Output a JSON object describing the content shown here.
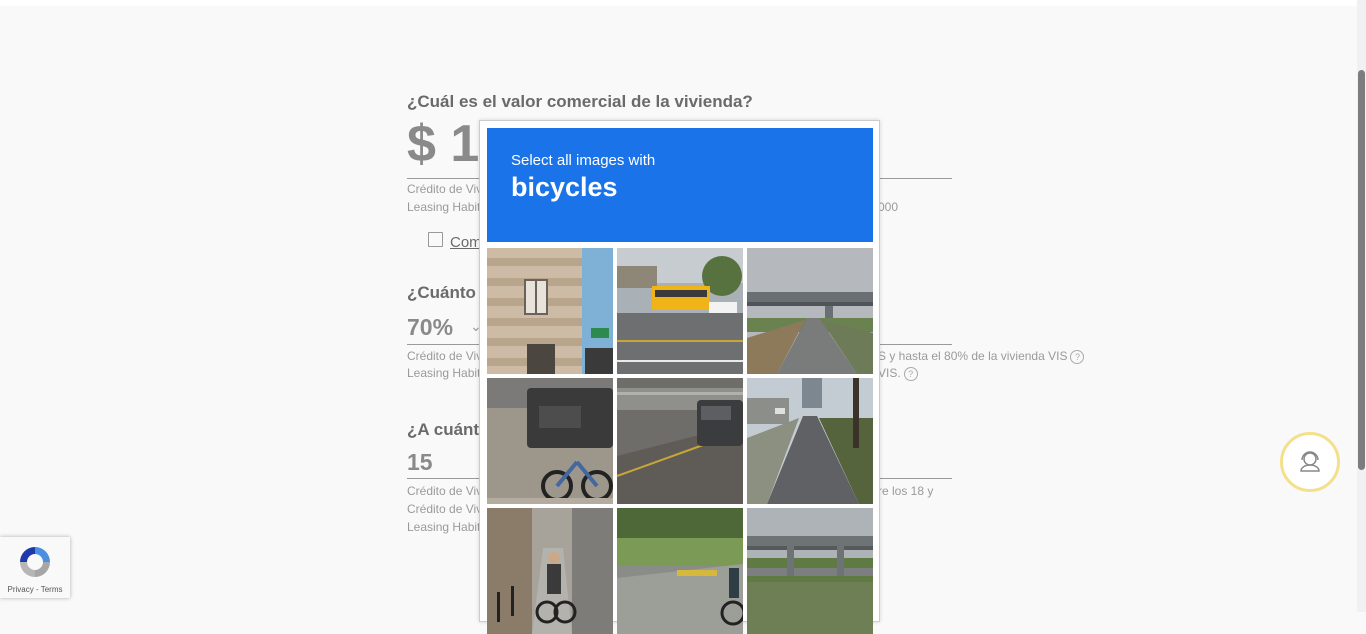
{
  "form": {
    "q1": {
      "label": "¿Cuál es el valor comercial de la vivienda?",
      "value": "$ 1",
      "note1": "Crédito de Viv",
      "note2": "Leasing Habit",
      "note_tail": "000",
      "link_label": "Com"
    },
    "q2": {
      "label": "¿Cuánto d",
      "value": "70%",
      "note1": "Crédito de Viv",
      "note2": "Leasing Habit",
      "note1_tail": "S y hasta el 80% de la vivienda VIS",
      "note2_tail": "VIS.",
      "help_glyph": "?"
    },
    "q3": {
      "label": "¿A cuánto",
      "value": "15",
      "note1": "Crédito de Viv",
      "note2": "Crédito de Viv",
      "note3": "Leasing Habit",
      "note1_tail": "re los 18 y"
    }
  },
  "captcha": {
    "instruction": "Select all images with",
    "target": "bicycles",
    "tiles": [
      "brick-building-street-sign",
      "school-bus-highway",
      "highway-overpass",
      "car-with-bicycles-rack",
      "suv-on-highway",
      "city-street-parked-cars",
      "person-riding-bicycle-street",
      "cyclist-on-sidewalk",
      "overpass-and-field"
    ]
  },
  "recaptcha_badge": {
    "links": "Privacy - Terms"
  },
  "colors": {
    "captcha_header": "#1a73e8",
    "support_ring": "#f3e08a"
  }
}
